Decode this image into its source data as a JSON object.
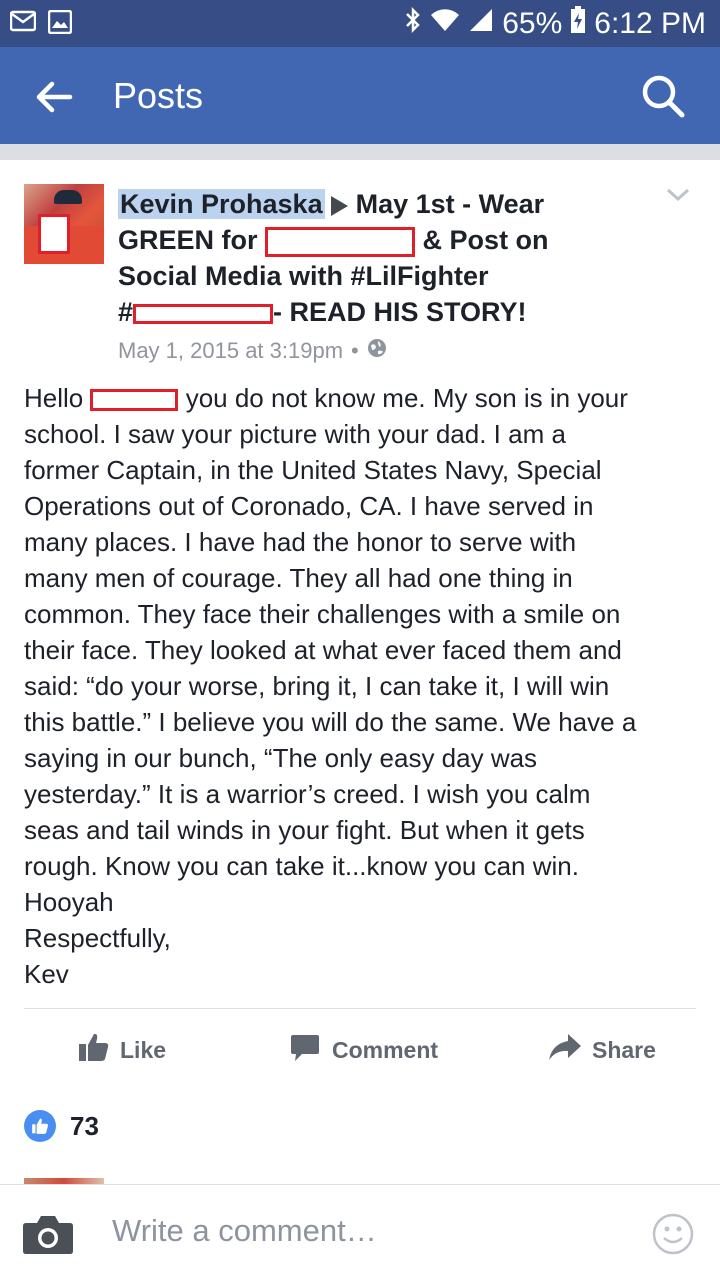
{
  "status_bar": {
    "battery": "65%",
    "time": "6:12 PM",
    "icons": [
      "mail-icon",
      "image-icon",
      "bluetooth-icon",
      "wifi-icon",
      "signal-icon",
      "battery-charging-icon"
    ]
  },
  "app_bar": {
    "title": "Posts",
    "back_icon": "arrow-left-icon",
    "search_icon": "search-icon"
  },
  "post": {
    "author": "Kevin Prohaska",
    "target_pre": "May 1st - Wear",
    "target_line2_pre": "GREEN for",
    "target_line2_post": "& Post on",
    "target_line3": "Social Media with #LilFighter",
    "target_line4_pre": "#",
    "target_line4_post": "- READ HIS STORY!",
    "timestamp": "May 1, 2015 at 3:19pm",
    "separator": "•",
    "privacy_icon": "globe-icon",
    "greeting": "Hello",
    "body_first_line_rest": " you do not know me.  My son is in your",
    "body_rest": "school.  I saw your picture with your dad.  I am a\nformer Captain, in the United States Navy, Special\nOperations out of Coronado, CA.  I have served in\nmany places.  I have had the honor to serve with\nmany men of courage.  They all had one thing in\ncommon.  They face their challenges with a smile on\ntheir face.  They looked at what ever faced them and\nsaid: “do your worse, bring it, I can take it, I will win\nthis battle.”  I believe you will do the same.  We have a\nsaying in our bunch, “The only easy day was\nyesterday.”  It is a warrior’s creed.  I wish you calm\nseas and tail winds in your fight. But when it gets\nrough. Know you can take it...know you can win.\nHooyah\nRespectfully,\nKev"
  },
  "actions": {
    "like": "Like",
    "comment": "Comment",
    "share": "Share"
  },
  "reactions": {
    "count": "73"
  },
  "composer": {
    "placeholder": "Write a comment…"
  },
  "colors": {
    "header_blue": "#4267b2",
    "status_blue": "#364e85",
    "author_highlight": "#bcd3f0",
    "redaction_red": "#e11f2a",
    "action_grey": "#606770",
    "like_blue": "#4b8ef2"
  }
}
